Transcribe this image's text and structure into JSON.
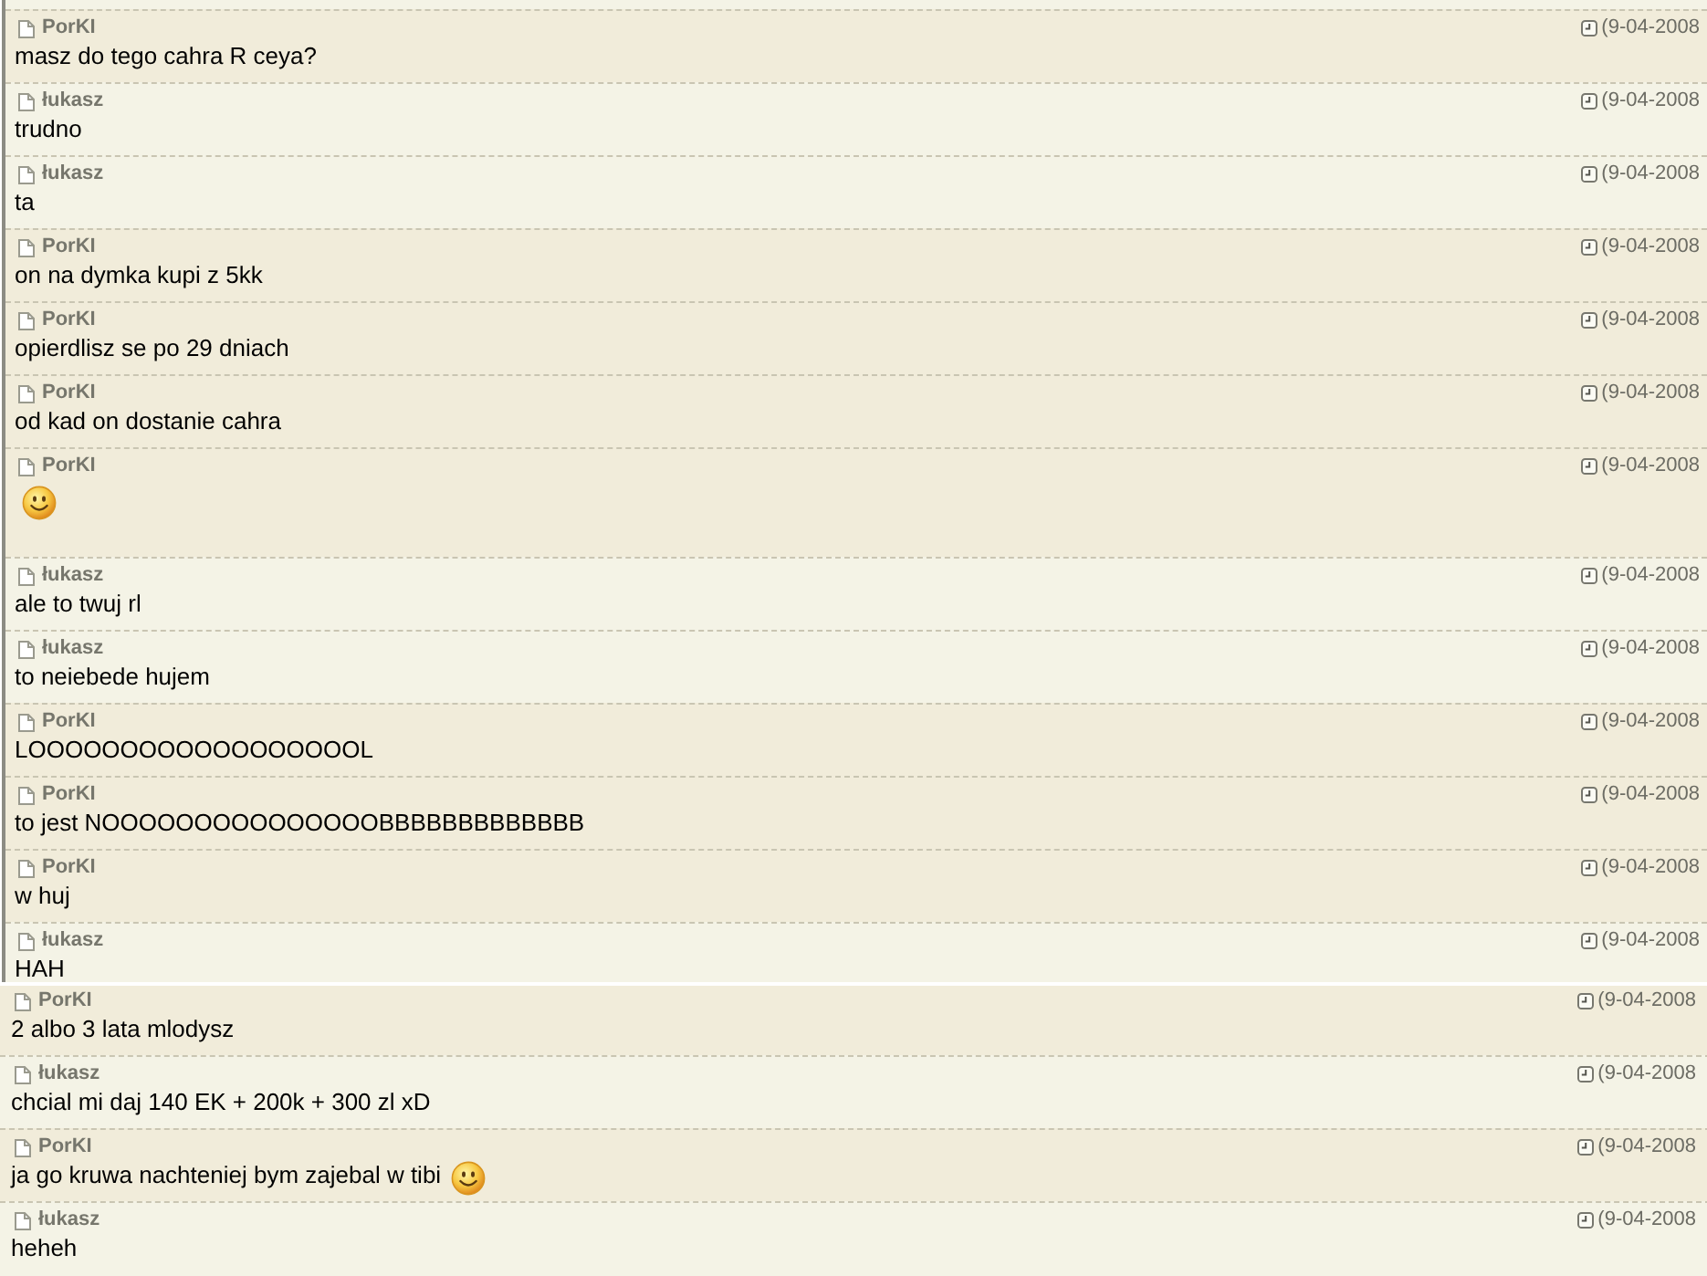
{
  "panels": [
    {
      "messages": [
        {
          "author": "PorKI",
          "time": "(9-04-2008",
          "text": "masz do tego cahra R ceya?",
          "shaded": true,
          "emoticon": false
        },
        {
          "author": "łukasz",
          "time": "(9-04-2008",
          "text": "trudno",
          "shaded": false,
          "emoticon": false
        },
        {
          "author": "łukasz",
          "time": "(9-04-2008",
          "text": "ta",
          "shaded": false,
          "emoticon": false
        },
        {
          "author": "PorKI",
          "time": "(9-04-2008",
          "text": "on na dymka kupi z 5kk",
          "shaded": true,
          "emoticon": false
        },
        {
          "author": "PorKI",
          "time": "(9-04-2008",
          "text": "opierdlisz se po 29 dniach",
          "shaded": true,
          "emoticon": false
        },
        {
          "author": "PorKI",
          "time": "(9-04-2008",
          "text": "od kad on dostanie cahra",
          "shaded": true,
          "emoticon": false
        },
        {
          "author": "PorKI",
          "time": "(9-04-2008",
          "shaded": true,
          "emoticon": true
        },
        {
          "author": "łukasz",
          "time": "(9-04-2008",
          "text": "ale to twuj rl",
          "shaded": false,
          "emoticon": false
        },
        {
          "author": "łukasz",
          "time": "(9-04-2008",
          "text": "to neiebede hujem",
          "shaded": false,
          "emoticon": false
        },
        {
          "author": "PorKI",
          "time": "(9-04-2008",
          "text": "LOOOOOOOOOOOOOOOOOOL",
          "shaded": true,
          "emoticon": false
        },
        {
          "author": "PorKI",
          "time": "(9-04-2008",
          "text": "to jest NOOOOOOOOOOOOOOOBBBBBBBBBBBBB",
          "shaded": true,
          "emoticon": false
        },
        {
          "author": "PorKI",
          "time": "(9-04-2008",
          "text": "w huj",
          "shaded": true,
          "emoticon": false
        },
        {
          "author": "łukasz",
          "time": "(9-04-2008",
          "text": "HAH",
          "shaded": false,
          "emoticon": false
        }
      ]
    },
    {
      "messages": [
        {
          "author": "PorKI",
          "time": "(9-04-2008",
          "text": "2 albo 3 lata mlodysz",
          "shaded": true,
          "emoticon": false
        },
        {
          "author": "łukasz",
          "time": "(9-04-2008",
          "text": "chcial mi daj 140 EK + 200k + 300 zl xD",
          "shaded": false,
          "emoticon": false
        },
        {
          "author": "PorKI",
          "time": "(9-04-2008",
          "text": "ja go kruwa nachteniej bym zajebal w tibi",
          "shaded": true,
          "emoticon": true
        },
        {
          "author": "łukasz",
          "time": "(9-04-2008",
          "text": "heheh",
          "shaded": false,
          "emoticon": false
        }
      ]
    }
  ]
}
